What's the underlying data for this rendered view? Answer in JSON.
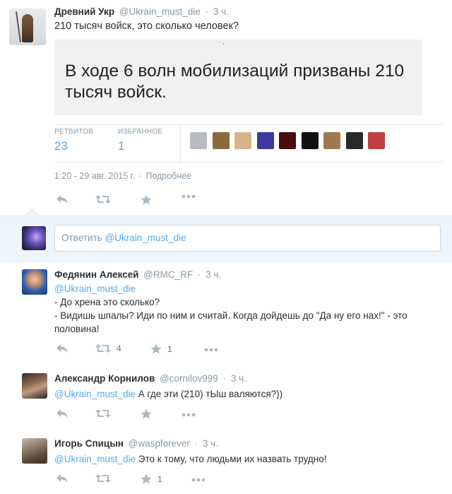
{
  "tweet": {
    "fullname": "Древний Укр",
    "handle": "@Ukrain_must_die",
    "dot": "·",
    "time": "3 ч.",
    "text": "210 тысяч войск, это сколько человек?",
    "image_text": "В ходе 6 волн мобилизаций призваны 210 тысяч войск.",
    "stats": {
      "retweets_label": "РЕТВИТОВ",
      "retweets": "23",
      "favorites_label": "ИЗБРАННОЕ",
      "favorites": "1"
    },
    "timestamp": "1:20 - 29 авг. 2015 г.",
    "timestamp_sep": "·",
    "details_link": "Подробнее"
  },
  "favoriters": [
    {
      "name": "favoriter-1",
      "color": "#b8bcc0"
    },
    {
      "name": "favoriter-2",
      "color": "#8a6a3a"
    },
    {
      "name": "favoriter-3",
      "color": "#d6b48a"
    },
    {
      "name": "favoriter-4",
      "color": "#3a3aa0"
    },
    {
      "name": "favoriter-5",
      "color": "#4a0d0d"
    },
    {
      "name": "favoriter-6",
      "color": "#111111"
    },
    {
      "name": "favoriter-7",
      "color": "#a07850"
    },
    {
      "name": "favoriter-8",
      "color": "#2a2a2a"
    },
    {
      "name": "favoriter-9",
      "color": "#c04040"
    }
  ],
  "reply_box": {
    "prefix": "Ответить",
    "mention": "@Ukrain_must_die"
  },
  "replies": [
    {
      "fullname": "Федянин Алексей",
      "handle": "@RMC_RF",
      "dot": "·",
      "time": "3 ч.",
      "mention": "@Ukrain_must_die",
      "lines": [
        "- До хрена это сколько?",
        "- Видишь шпалы? Иди по ним и считай. Когда дойдешь до \"Да ну его нах!\" - это половина!"
      ],
      "retweets": "4",
      "favorites": "1",
      "avatar_color": "#2a5fa8"
    },
    {
      "fullname": "Александр Корнилов",
      "handle": "@cornilov999",
      "dot": "·",
      "time": "3 ч.",
      "mention": "@Ukrain_must_die",
      "text": "А где эти (210) тЫш валяются?))",
      "retweets": "",
      "favorites": "",
      "avatar_color": "#6b4a3a"
    },
    {
      "fullname": "Игорь Спицын",
      "handle": "@waspforever",
      "dot": "·",
      "time": "3 ч.",
      "mention": "@Ukrain_must_die",
      "text": "Это к тому, что людьми их назвать трудно!",
      "retweets": "",
      "favorites": "1",
      "avatar_color": "#7a6a5a"
    }
  ],
  "icons": {
    "reply": "reply-icon",
    "retweet": "retweet-icon",
    "favorite": "star-icon",
    "more": "more-icon"
  },
  "colors": {
    "link": "#55acee",
    "muted": "#8899a6",
    "icon": "#aab8c2",
    "reply_bg": "#eef5fa"
  }
}
